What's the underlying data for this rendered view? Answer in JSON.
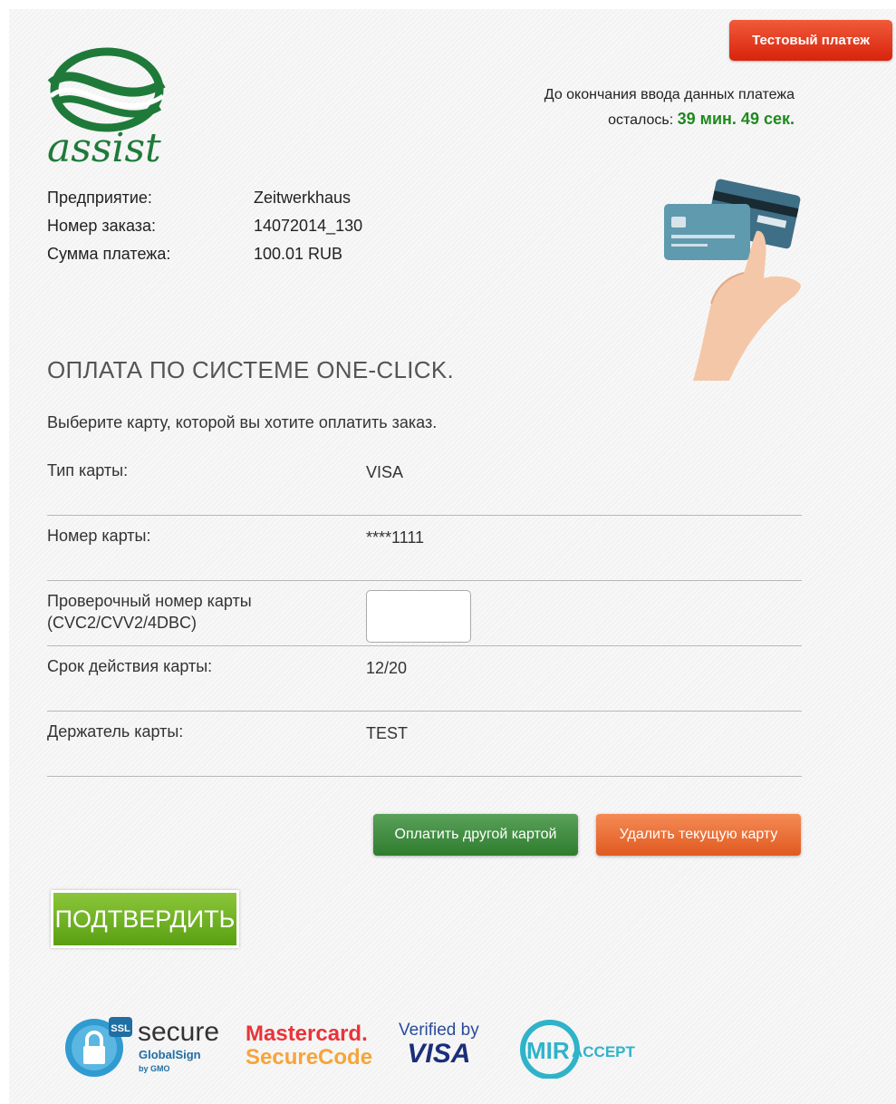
{
  "header": {
    "test_badge": "Тестовый платеж",
    "logo_text": "assist",
    "timer_line1": "До окончания ввода данных платежа",
    "timer_line2_prefix": "осталось:",
    "timer_remaining": "39 мин. 49 сек."
  },
  "order": {
    "rows": [
      {
        "label": "Предприятие:",
        "value": "Zeitwerkhaus"
      },
      {
        "label": "Номер заказа:",
        "value": "14072014_130"
      },
      {
        "label": "Сумма платежа:",
        "value": "100.01 RUB"
      }
    ]
  },
  "payment": {
    "title": "ОПЛАТА ПО СИСТЕМЕ ONE-CLICK.",
    "subtitle": "Выберите карту, которой вы хотите оплатить заказ.",
    "card_type_label": "Тип карты:",
    "card_type_value": "VISA",
    "card_number_label": "Номер карты:",
    "card_number_value": "****1111",
    "cvc_label_line1": "Проверочный номер карты",
    "cvc_label_line2": "(CVC2/CVV2/4DBC)",
    "cvc_value": "",
    "expiry_label": "Срок действия карты:",
    "expiry_value": "12/20",
    "holder_label": "Держатель карты:",
    "holder_value": "TEST"
  },
  "actions": {
    "other_card": "Оплатить другой картой",
    "delete_card": "Удалить текущую карту",
    "confirm": "ПОДТВЕРДИТЬ"
  },
  "footer": {
    "ssl_badge": "SSL",
    "ssl_secure": "secure",
    "ssl_globalsign": "GlobalSign",
    "ssl_gmo": "by GMO",
    "mastercard_line1": "Mastercard.",
    "mastercard_line2": "SecureCode",
    "visa_line1": "Verified by",
    "visa_line2": "VISA",
    "mir_text": "MIR",
    "mir_accept": "ACCEPT"
  },
  "colors": {
    "accent_green": "#1e8a1e",
    "badge_red": "#d8230d",
    "delete_orange": "#e05a20",
    "confirm_green": "#5aa012"
  }
}
